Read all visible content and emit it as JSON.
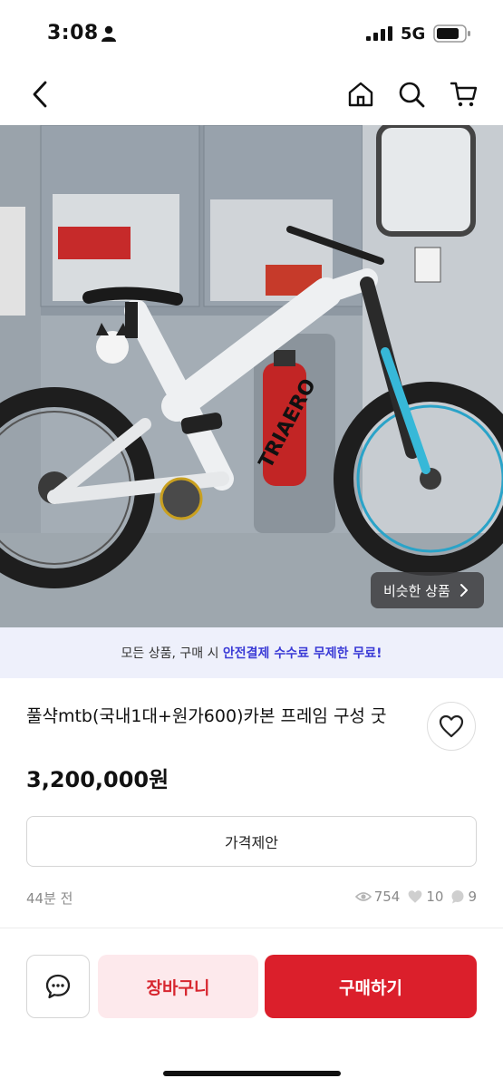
{
  "status_bar": {
    "time": "3:08",
    "network": "5G"
  },
  "nav": {
    "back_icon": "chevron-left-icon",
    "home_icon": "home-icon",
    "search_icon": "search-icon",
    "cart_icon": "cart-icon"
  },
  "image": {
    "similar_label": "비슷한 상품"
  },
  "banner": {
    "prefix": "모든 상품, 구매 시 ",
    "highlight": "안전결제 수수료 무제한 무료!"
  },
  "product": {
    "title": "풀샥mtb(국내1대+원가600)카본 프레임 구성 굿",
    "price": "3,200,000원",
    "offer_label": "가격제안",
    "time_ago": "44분 전",
    "views": "754",
    "likes": "10",
    "chats": "9"
  },
  "actions": {
    "cart_label": "장바구니",
    "buy_label": "구매하기"
  },
  "colors": {
    "accent": "#db1f2b",
    "banner_bg": "#eef0fb",
    "banner_highlight": "#3a3ad6",
    "cart_bg": "#fde9ec"
  }
}
